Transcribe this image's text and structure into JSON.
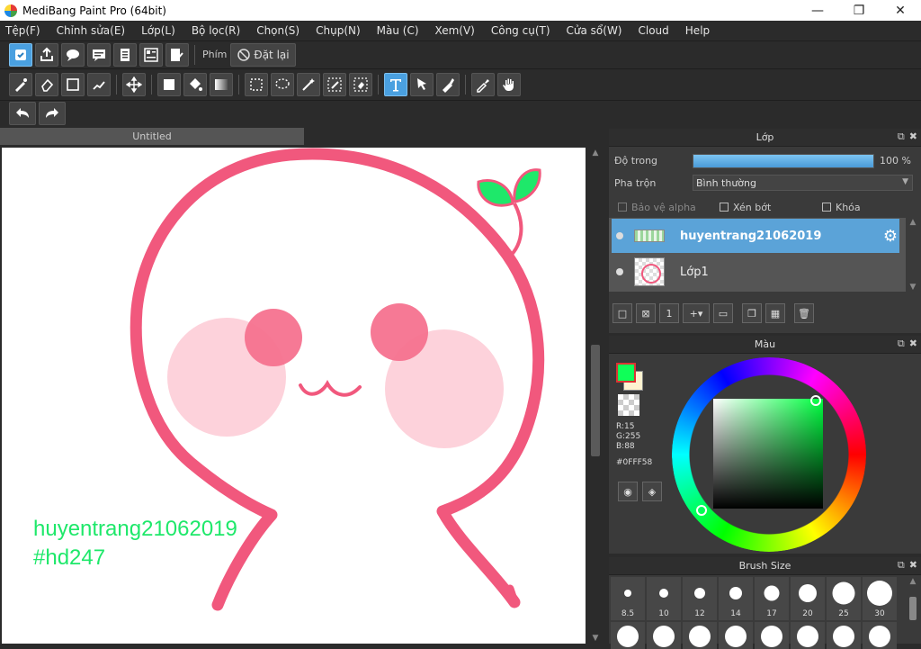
{
  "window": {
    "title": "MediBang Paint Pro (64bit)"
  },
  "menu": [
    "Tệp(F)",
    "Chỉnh sửa(E)",
    "Lớp(L)",
    "Bộ lọc(R)",
    "Chọn(S)",
    "Chụp(N)",
    "Màu (C)",
    "Xem(V)",
    "Công cụ(T)",
    "Cửa sổ(W)",
    "Cloud",
    "Help"
  ],
  "toolbar": {
    "phim_label": "Phím",
    "reset_label": "Đặt lại",
    "active_tool": "text-tool"
  },
  "document": {
    "tab_title": "Untitled"
  },
  "canvas": {
    "text_line1": "huyentrang21062019",
    "text_line2": "#hd247"
  },
  "layer_panel": {
    "title": "Lớp",
    "opacity_label": "Độ trong",
    "opacity_value": "100 %",
    "opacity_level": 1.0,
    "blend_label": "Pha trộn",
    "blend_value": "Bình thường",
    "protect_alpha": "Bảo vệ alpha",
    "clip": "Xén bớt",
    "lock": "Khóa",
    "layers": [
      {
        "name": "huyentrang21062019",
        "selected": true
      },
      {
        "name": "Lớp1",
        "selected": false
      }
    ]
  },
  "color_panel": {
    "title": "Màu",
    "r": "R:15",
    "g": "G:255",
    "b": "B:88",
    "hex": "#0FFF58",
    "foreground": "#0FFF58",
    "background": "#FFF3D1"
  },
  "brush_panel": {
    "title": "Brush Size",
    "sizes": [
      "8.5",
      "10",
      "12",
      "14",
      "17",
      "20",
      "25",
      "30"
    ]
  }
}
